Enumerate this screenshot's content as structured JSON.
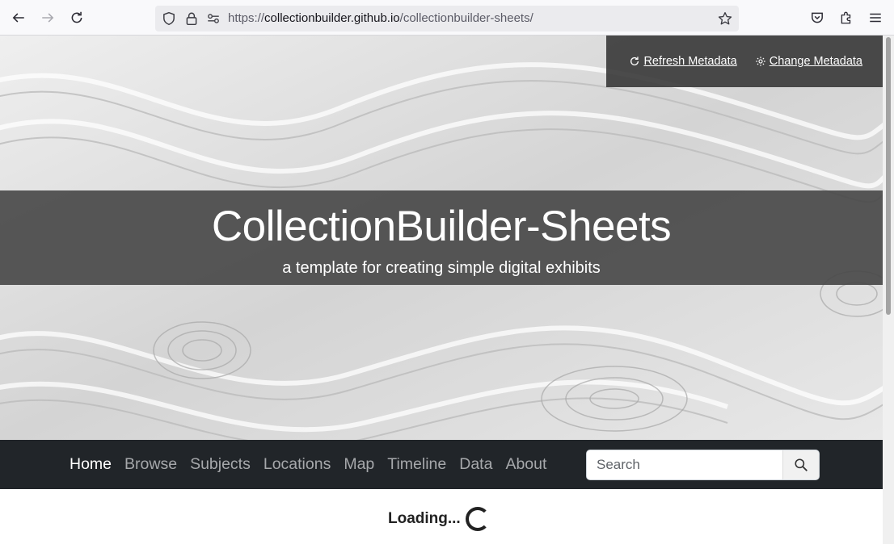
{
  "browser": {
    "url_prefix": "https://",
    "url_host": "collectionbuilder.github.io",
    "url_path": "/collectionbuilder-sheets/"
  },
  "hero": {
    "meta_links": [
      "Refresh Metadata",
      "Change Metadata"
    ],
    "title": "CollectionBuilder-Sheets",
    "subtitle": "a template for creating simple digital exhibits"
  },
  "nav": {
    "items": [
      "Home",
      "Browse",
      "Subjects",
      "Locations",
      "Map",
      "Timeline",
      "Data",
      "About"
    ],
    "active": "Home"
  },
  "search": {
    "placeholder": "Search"
  },
  "status": {
    "loading": "Loading..."
  }
}
